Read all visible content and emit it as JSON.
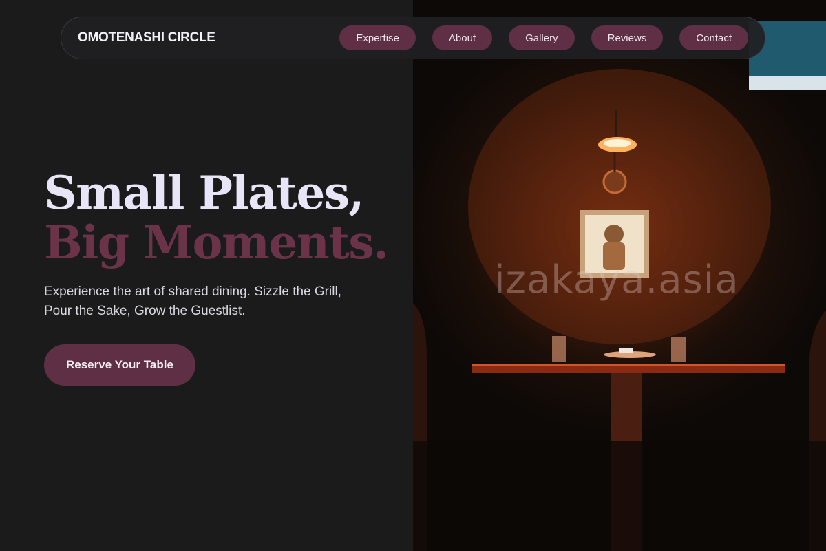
{
  "brand": "OMOTENASHI CIRCLE",
  "nav": {
    "links": [
      "Expertise",
      "About",
      "Gallery",
      "Reviews",
      "Contact"
    ]
  },
  "hero": {
    "title_line1": "Small Plates,",
    "title_line2": "Big Moments.",
    "subtitle": "Experience the art of shared dining. Sizzle the Grill, Pour the Sake, Grow the Guestlist.",
    "cta": "Reserve Your Table"
  },
  "photo": {
    "watermark": "izakaya.asia"
  },
  "colors": {
    "background": "#1b1b1c",
    "accent": "#5e2f45",
    "title_light": "#e8e6f6",
    "title_accent": "#6a3348"
  }
}
